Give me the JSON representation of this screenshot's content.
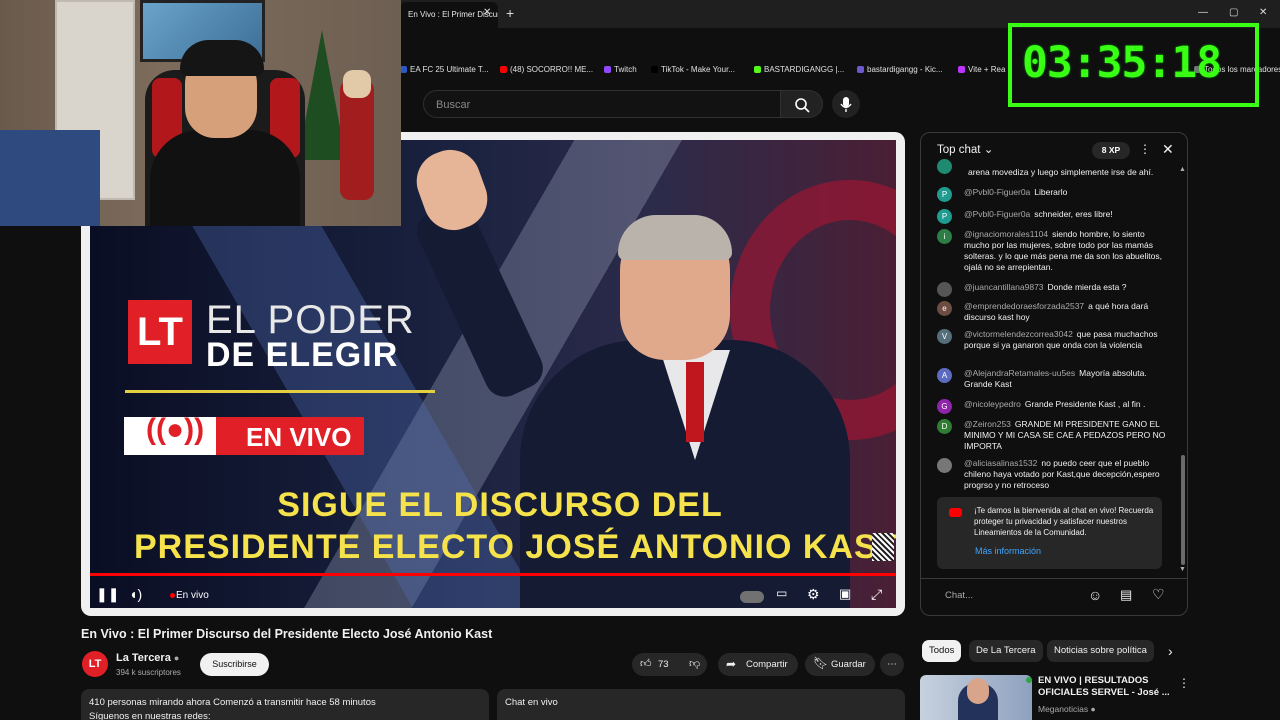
{
  "browser": {
    "active_tab": "En Vivo : El Primer Discurso",
    "bookmarks": [
      {
        "label": "EA FC 25 Ultimate T...",
        "color": "#2b59c3"
      },
      {
        "label": "(48) SOCORRO!! ME...",
        "color": "#ff0000"
      },
      {
        "label": "Twitch",
        "color": "#9146ff"
      },
      {
        "label": "TikTok - Make Your...",
        "color": "#000000"
      },
      {
        "label": "BASTARDIGANGG |...",
        "color": "#53fc18"
      },
      {
        "label": "bastardigangg - Kic...",
        "color": "#6a5acd"
      },
      {
        "label": "Vite + Rea",
        "color": "#bd34fe"
      },
      {
        "label": "Todos los marcadores",
        "color": "#777777"
      }
    ]
  },
  "header": {
    "search_placeholder": "Buscar"
  },
  "timer": {
    "value": "03:35:18",
    "color": "#39ff14"
  },
  "video": {
    "brand_logo": "LT",
    "brand_line1": "EL PODER",
    "brand_line2": "DE ELEGIR",
    "live_badge": "EN VIVO",
    "headline_line1": "SIGUE EL DISCURSO DEL",
    "headline_line2": "PRESIDENTE ELECTO JOSÉ ANTONIO KAST",
    "live_status": "En vivo"
  },
  "watch": {
    "title": "En Vivo : El Primer Discurso del Presidente Electo José Antonio Kast",
    "channel": {
      "name": "La Tercera",
      "avatar_letters": "LT",
      "subscribers": "394 k suscriptores"
    },
    "subscribe_label": "Suscribirse",
    "likes": "73",
    "share_label": "Compartir",
    "save_label": "Guardar",
    "description_line1": "410 personas mirando ahora  Comenzó a transmitir hace 58 minutos",
    "description_line2": "Síguenos en nuestras redes:",
    "chat_replay_label": "Chat en vivo"
  },
  "chat": {
    "mode": "Top chat",
    "xp": "8 XP",
    "messages": [
      {
        "user": "",
        "text": "arena movediza y luego simplemente irse de ahí.",
        "avatar": "",
        "color": "#1f8a70"
      },
      {
        "user": "@Pvbl0-Figuer0a",
        "text": "Liberarlo",
        "avatar": "P",
        "color": "#1f9b8f"
      },
      {
        "user": "@Pvbl0-Figuer0a",
        "text": "schneider, eres libre!",
        "avatar": "P",
        "color": "#1f9b8f"
      },
      {
        "user": "@ignaciomorales1104",
        "text": "siendo hombre, lo siento mucho por las mujeres, sobre todo por las mamás solteras. y lo que más pena me da son los abuelitos, ojalá no se arrepientan.",
        "avatar": "i",
        "color": "#2d7d46"
      },
      {
        "user": "@juancantillana9873",
        "text": "Donde mierda esta ?",
        "avatar": "",
        "color": "#555555"
      },
      {
        "user": "@emprendedoraesforzada2537",
        "text": "a qué hora dará discurso kast hoy",
        "avatar": "e",
        "color": "#6d4c41"
      },
      {
        "user": "@victormelendezcorrea3042",
        "text": "que pasa muchachos porque si ya ganaron que onda con la violencia",
        "avatar": "V",
        "color": "#546e7a"
      },
      {
        "user": "@AlejandraRetamales-uu5es",
        "text": "Mayoría absoluta. Grande Kast",
        "avatar": "A",
        "color": "#5c6bc0"
      },
      {
        "user": "@nicoleypedro",
        "text": "Grande Presidente Kast , al fin .",
        "avatar": "G",
        "color": "#8e24aa"
      },
      {
        "user": "@Zeiron253",
        "text": "GRANDE MI PRESIDENTE GANO EL MINIMO Y MI CASA SE CAE A PEDAZOS PERO NO IMPORTA",
        "avatar": "D",
        "color": "#2e7d32"
      },
      {
        "user": "@aliciasalinas1532",
        "text": "no puedo ceer que el pueblo chileno haya votado por Kast,que decepción,espero progrso y no retroceso",
        "avatar": "",
        "color": "#777777"
      }
    ],
    "welcome": "¡Te damos la bienvenida al chat en vivo! Recuerda proteger tu privacidad y satisfacer nuestros Lineamientos de la Comunidad.",
    "welcome_link": "Más información",
    "input_placeholder": "Chat..."
  },
  "recommendations": {
    "chips": [
      "Todos",
      "De La Tercera",
      "Noticias sobre política"
    ],
    "items": [
      {
        "title": "EN VIVO | RESULTADOS OFICIALES SERVEL - José ...",
        "channel": "Meganoticias"
      }
    ]
  }
}
